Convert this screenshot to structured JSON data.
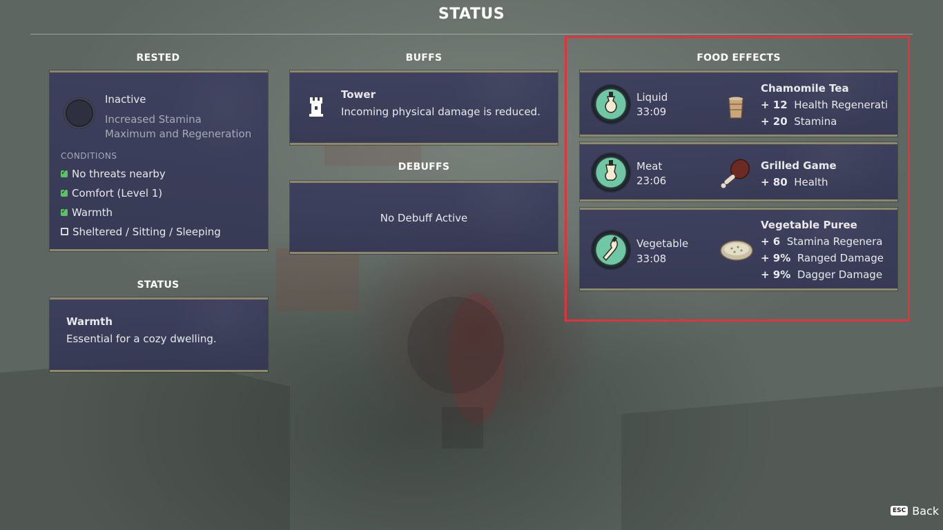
{
  "screen_title": "STATUS",
  "rested": {
    "heading": "RESTED",
    "state": "Inactive",
    "desc_line1": "Increased Stamina",
    "desc_line2": "Maximum and Regeneration",
    "conditions_label": "CONDITIONS",
    "conditions": [
      {
        "label": "No threats nearby",
        "met": true
      },
      {
        "label": "Comfort (Level 1)",
        "met": true
      },
      {
        "label": "Warmth",
        "met": true
      },
      {
        "label": "Sheltered / Sitting / Sleeping",
        "met": false
      }
    ]
  },
  "status": {
    "heading": "STATUS",
    "name": "Warmth",
    "desc": "Essential for a cozy dwelling."
  },
  "buffs": {
    "heading": "BUFFS",
    "name": "Tower",
    "desc": "Incoming physical damage is reduced.",
    "icon": "tower-icon"
  },
  "debuffs": {
    "heading": "DEBUFFS",
    "empty_text": "No Debuff Active"
  },
  "food_effects": {
    "heading": "FOOD EFFECTS",
    "items": [
      {
        "category": "Liquid",
        "timer": "33:09",
        "food": "Chamomile Tea",
        "icon": "tea-icon",
        "effects": [
          {
            "value": "+ 12",
            "stat": "Health Regeneratio"
          },
          {
            "value": "+ 20",
            "stat": "Stamina"
          }
        ]
      },
      {
        "category": "Meat",
        "timer": "23:06",
        "food": "Grilled Game",
        "icon": "meat-icon",
        "effects": [
          {
            "value": "+ 80",
            "stat": "Health"
          }
        ]
      },
      {
        "category": "Vegetable",
        "timer": "33:08",
        "food": "Vegetable Puree",
        "icon": "puree-icon",
        "effects": [
          {
            "value": "+ 6",
            "stat": "Stamina Regenera"
          },
          {
            "value": "+ 9%",
            "stat": "Ranged Damage"
          },
          {
            "value": "+ 9%",
            "stat": "Dagger Damage"
          }
        ]
      }
    ]
  },
  "footer": {
    "key": "ESC",
    "back_label": "Back"
  },
  "colors": {
    "highlight": "#e0333a",
    "panel": "#3a3c5c",
    "food_ring": "#6fc7a6",
    "check": "#5fbf6a"
  }
}
